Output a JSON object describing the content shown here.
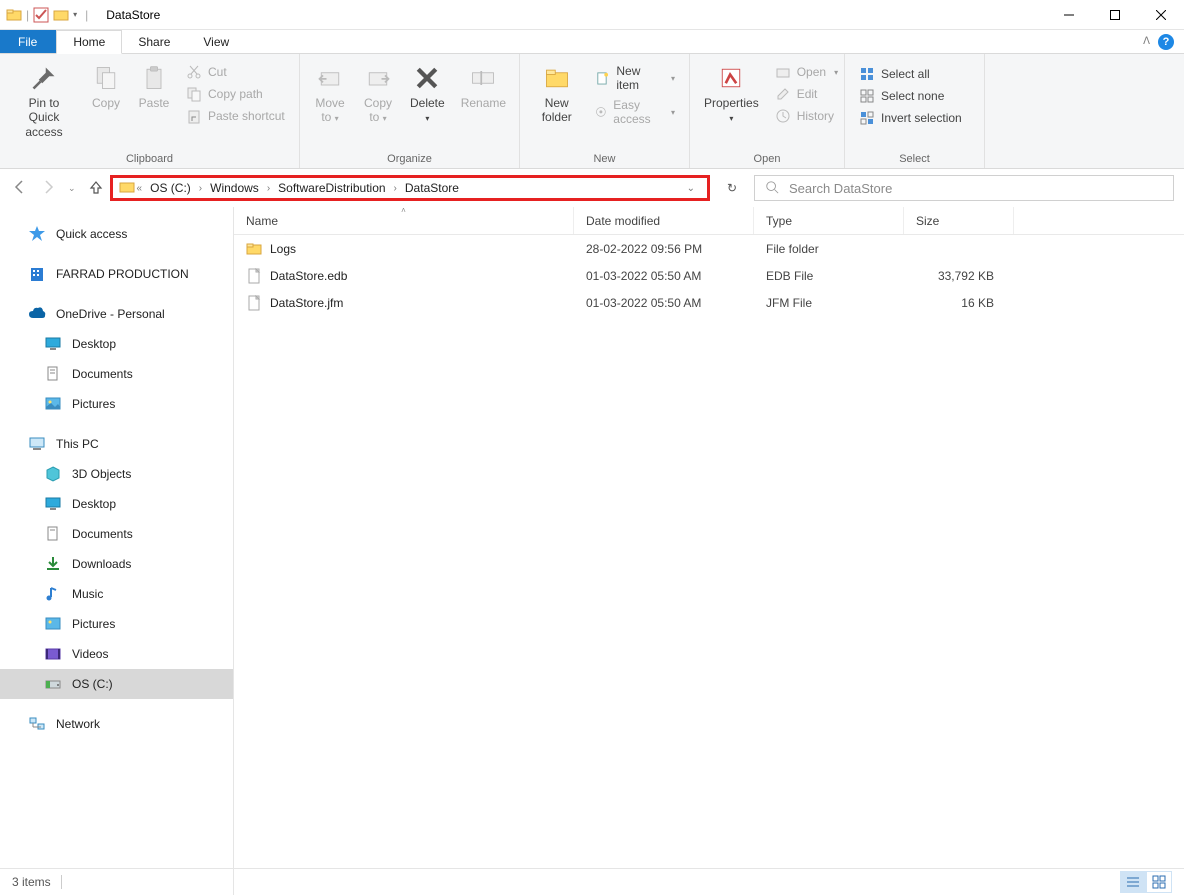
{
  "title": "DataStore",
  "tabs": {
    "file": "File",
    "home": "Home",
    "share": "Share",
    "view": "View"
  },
  "ribbon": {
    "clipboard": {
      "label": "Clipboard",
      "pin": "Pin to Quick access",
      "copy": "Copy",
      "paste": "Paste",
      "cut": "Cut",
      "copypath": "Copy path",
      "pastesc": "Paste shortcut"
    },
    "organize": {
      "label": "Organize",
      "moveto": "Move to",
      "copyto": "Copy to",
      "delete": "Delete",
      "rename": "Rename"
    },
    "new": {
      "label": "New",
      "newfolder": "New folder",
      "newitem": "New item",
      "easyaccess": "Easy access"
    },
    "open": {
      "label": "Open",
      "properties": "Properties",
      "open": "Open",
      "edit": "Edit",
      "history": "History"
    },
    "select": {
      "label": "Select",
      "selectall": "Select all",
      "selectnone": "Select none",
      "invert": "Invert selection"
    }
  },
  "breadcrumb": [
    "OS (C:)",
    "Windows",
    "SoftwareDistribution",
    "DataStore"
  ],
  "search_placeholder": "Search DataStore",
  "sidebar": {
    "quick": "Quick access",
    "farrad": "FARRAD PRODUCTION",
    "onedrive": "OneDrive - Personal",
    "od_desktop": "Desktop",
    "od_documents": "Documents",
    "od_pictures": "Pictures",
    "thispc": "This PC",
    "pc_3d": "3D Objects",
    "pc_desktop": "Desktop",
    "pc_documents": "Documents",
    "pc_downloads": "Downloads",
    "pc_music": "Music",
    "pc_pictures": "Pictures",
    "pc_videos": "Videos",
    "pc_os": "OS (C:)",
    "network": "Network"
  },
  "columns": {
    "name": "Name",
    "date": "Date modified",
    "type": "Type",
    "size": "Size"
  },
  "rows": [
    {
      "name": "Logs",
      "date": "28-02-2022 09:56 PM",
      "type": "File folder",
      "size": "",
      "icon": "folder"
    },
    {
      "name": "DataStore.edb",
      "date": "01-03-2022 05:50 AM",
      "type": "EDB File",
      "size": "33,792 KB",
      "icon": "file"
    },
    {
      "name": "DataStore.jfm",
      "date": "01-03-2022 05:50 AM",
      "type": "JFM File",
      "size": "16 KB",
      "icon": "file"
    }
  ],
  "status": "3 items"
}
